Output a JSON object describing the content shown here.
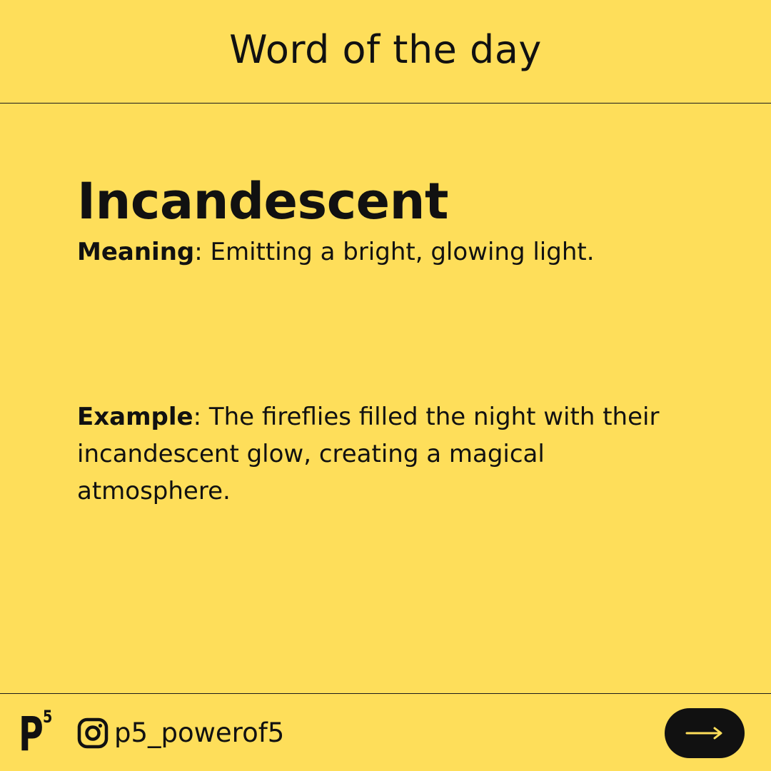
{
  "header": {
    "title": "Word of the day"
  },
  "entry": {
    "word": "Incandescent",
    "meaning_label": "Meaning",
    "meaning_text": ": Emitting a bright, glowing light.",
    "example_label": "Example",
    "example_text": ": The fireflies filled the night with their incandescent glow, creating a magical atmosphere."
  },
  "footer": {
    "logo_letter": "P",
    "logo_superscript": "5",
    "social_icon": "instagram-icon",
    "handle": "p5_powerof5",
    "next_icon": "arrow-right-icon"
  },
  "colors": {
    "background": "#FEDE5A",
    "text": "#111111",
    "button": "#111111",
    "button_icon": "#FEDE5A"
  }
}
